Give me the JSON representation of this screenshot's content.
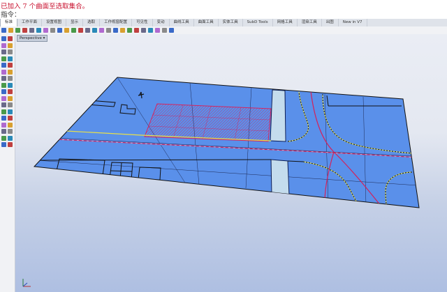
{
  "command": {
    "message": "已加入 7 个曲面至选取集合。",
    "prompt": "指令："
  },
  "tabs": [
    "标准",
    "工作平面",
    "设置视图",
    "显示",
    "选取",
    "工作视窗配置",
    "可见性",
    "变动",
    "曲线工具",
    "曲面工具",
    "实体工具",
    "SubD Tools",
    "网格工具",
    "渲染工具",
    "出图",
    "New in V7"
  ],
  "active_tab": "标准",
  "viewport": {
    "name": "Perspective",
    "has_menu_arrow": true
  },
  "icons": {
    "toolbar": [
      "new-file-icon",
      "open-icon",
      "save-icon",
      "print-icon",
      "import-icon",
      "cut-icon",
      "copy-icon",
      "paste-icon",
      "undo-icon",
      "redo-icon",
      "pan-icon",
      "rotate-view-icon",
      "zoom-icon",
      "zoom-window-icon",
      "zoom-extents-icon",
      "zoom-selected-icon",
      "four-views-icon",
      "grid-icon",
      "object-snap-icon",
      "layer-icon",
      "properties-icon",
      "render-icon",
      "material-icon",
      "light-icon",
      "help-icon"
    ],
    "left": [
      "select-icon",
      "point-icon",
      "line-icon",
      "polyline-icon",
      "curve-icon",
      "circle-icon",
      "arc-icon",
      "ellipse-icon",
      "rectangle-icon",
      "polygon-icon",
      "text-icon",
      "surface-icon",
      "loft-icon",
      "extrude-icon",
      "box-icon",
      "sphere-icon",
      "cylinder-icon",
      "boolean-icon",
      "mesh-icon",
      "fillet-icon",
      "trim-icon",
      "split-icon",
      "join-icon",
      "explode-icon",
      "move-icon",
      "copy-move-icon",
      "rotate-icon",
      "scale-icon",
      "mirror-icon",
      "array-icon",
      "group-icon",
      "dimension-icon",
      "analyze-icon",
      "block-icon"
    ]
  },
  "colors": {
    "ground_fill": "#5a90ea",
    "road_fill": "#5a90ea",
    "selection": "#d4205a",
    "highlight": "#e8e04a",
    "crosswalk": "#d6ecf5",
    "command_error": "#c8102e"
  }
}
